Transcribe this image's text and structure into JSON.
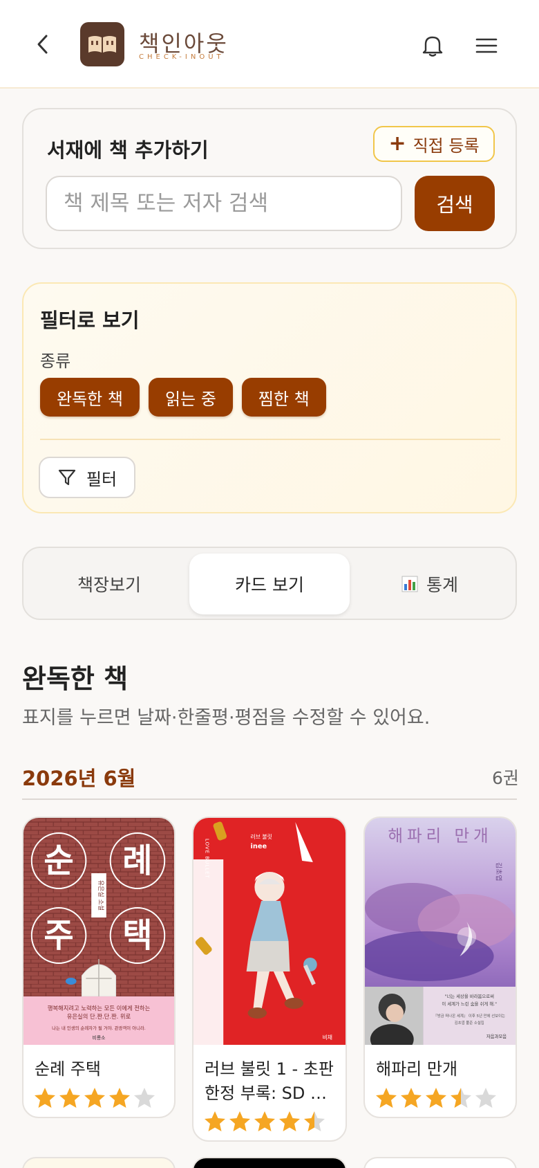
{
  "header": {
    "back_icon": "chevron-left-icon",
    "logo_icon": "open-book-icon",
    "title": "책인아웃",
    "subtitle": "CHECK-INOUT",
    "bell_icon": "bell-icon",
    "menu_icon": "hamburger-menu-icon"
  },
  "add_book": {
    "title": "서재에 책 추가하기",
    "direct_register": "직접 등록",
    "search_placeholder": "책 제목 또는 저자 검색",
    "search_button": "검색"
  },
  "filter": {
    "title": "필터로 보기",
    "category_label": "종류",
    "chips": [
      "완독한 책",
      "읽는 중",
      "찜한 책"
    ],
    "filter_button": "필터"
  },
  "tabs": [
    {
      "label": "책장보기",
      "active": false
    },
    {
      "label": "카드 보기",
      "active": true
    },
    {
      "label": "통계",
      "icon": "bar-chart-icon",
      "active": false
    }
  ],
  "section": {
    "title": "완독한 책",
    "description": "표지를 누르면 날짜·한줄평·평점을 수정할 수 있어요.",
    "month": "2026년 6월",
    "count": "6권"
  },
  "books": [
    {
      "title": "순례 주택",
      "rating": 4,
      "cover_text": {
        "big": [
          "순",
          "례",
          "주",
          "택"
        ],
        "author": "유은실 소설",
        "blurb1": "행복해지려고 노력하는 모든 이에게 전하는",
        "blurb2": "유은실의 단.짠.단.짠. 위로",
        "blurb3": "나는 내 인생의 순례자가 될 거야. 관광객이 아니라.",
        "publisher": "비룡소"
      }
    },
    {
      "title": "러브 불릿 1 - 초판 한정 부록: SD …",
      "title_line1": "러브 불릿 1 - 초판",
      "title_line2": "한정 부록: SD …",
      "rating": 4.5,
      "cover_text": {
        "series": "러브 불릿",
        "author": "inee",
        "big": "LOVE BULLET",
        "publisher": "비채"
      }
    },
    {
      "title": "해파리 만개",
      "rating": 3.5,
      "cover_text": {
        "title": "해파리 만개",
        "author": "김초엽",
        "quote1": "\"너는 세상을 바라봄으로써",
        "quote2": "이 세계가 느린 숨을 쉬게 해.\"",
        "note1": "『방금 떠나온 세계』 이후 5년 만에 선보이는",
        "note2": "김초엽 풀준 소설집",
        "publisher": "자음과모음"
      }
    }
  ],
  "colors": {
    "accent": "#983d00",
    "accent_text": "#8a3a0c",
    "chip_border": "#f1c64a",
    "star": "#f5a623",
    "star_empty": "#d9d9d9"
  }
}
